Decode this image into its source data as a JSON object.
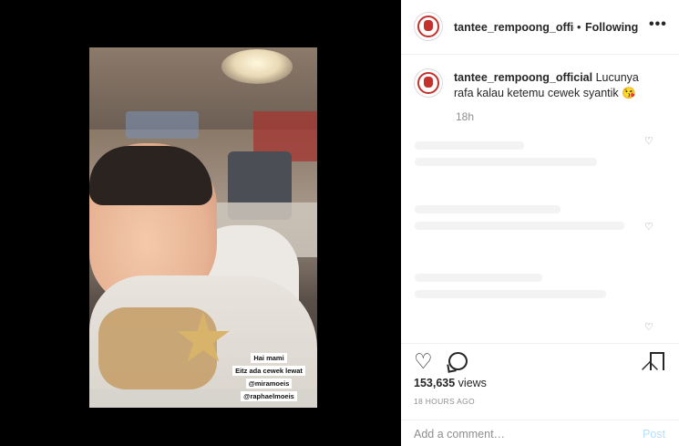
{
  "post": {
    "username": "tantee_rempoong_official",
    "username_truncated": "tantee_rempoong_offic",
    "separator": "•",
    "follow_status": "Following",
    "more": "•••",
    "caption_text": "Lucunya rafa kalau ketemu cewek syantik",
    "caption_emoji": "😘",
    "caption_time": "18h",
    "views_count": "153,635",
    "views_label": "views",
    "time_ago": "18 HOURS AGO",
    "comment_placeholder": "Add a comment…",
    "post_label": "Post"
  },
  "video_overlay": {
    "lines": [
      "Hai mami",
      "Eitz ada cewek lewat",
      "@miramoeis",
      "@raphaelmoeis"
    ]
  },
  "icons": {
    "like": "heart-icon",
    "comment": "comment-icon",
    "save": "bookmark-icon",
    "comment_like": "small-heart-icon"
  },
  "colors": {
    "text_primary": "#262626",
    "text_secondary": "#8e8e8e",
    "post_button_disabled": "#b2dffc",
    "avatar_accent": "#c4302b"
  }
}
